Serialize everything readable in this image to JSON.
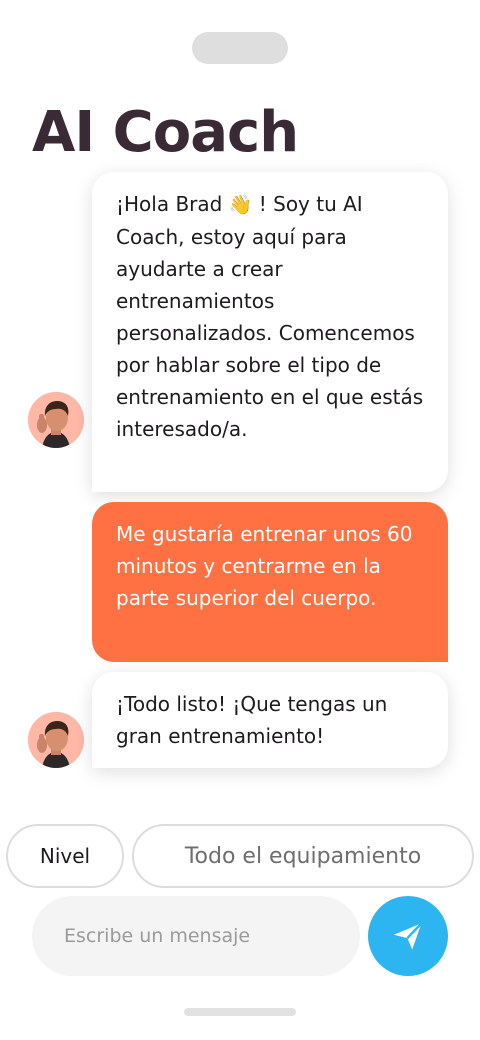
{
  "header": {
    "title": "AI Coach"
  },
  "messages": [
    {
      "role": "coach",
      "text_before": "¡Hola Brad ",
      "emoji": "👋",
      "text_after": " ! Soy tu AI Coach, estoy aquí para ayudarte a crear entrenamientos personalizados. Comencemos por hablar sobre el tipo de entrenamiento en el que estás interesado/a."
    },
    {
      "role": "user",
      "text": "Me gustaría entrenar unos 60 minutos y centrarme en la parte superior del cuerpo."
    },
    {
      "role": "coach",
      "text": "¡Todo listo! ¡Que tengas un gran entrenamiento!"
    }
  ],
  "filters": {
    "level_label": "Nivel",
    "equipment_label": "Todo el equipamiento"
  },
  "composer": {
    "placeholder": "Escribe un mensaje",
    "value": ""
  },
  "icons": {
    "send": "send-paper-plane-icon",
    "avatar": "coach-avatar"
  },
  "colors": {
    "title": "#3a2a35",
    "user_bubble": "#ff7043",
    "send_button": "#2db5f1",
    "avatar_bg": "#ffb8a6"
  }
}
